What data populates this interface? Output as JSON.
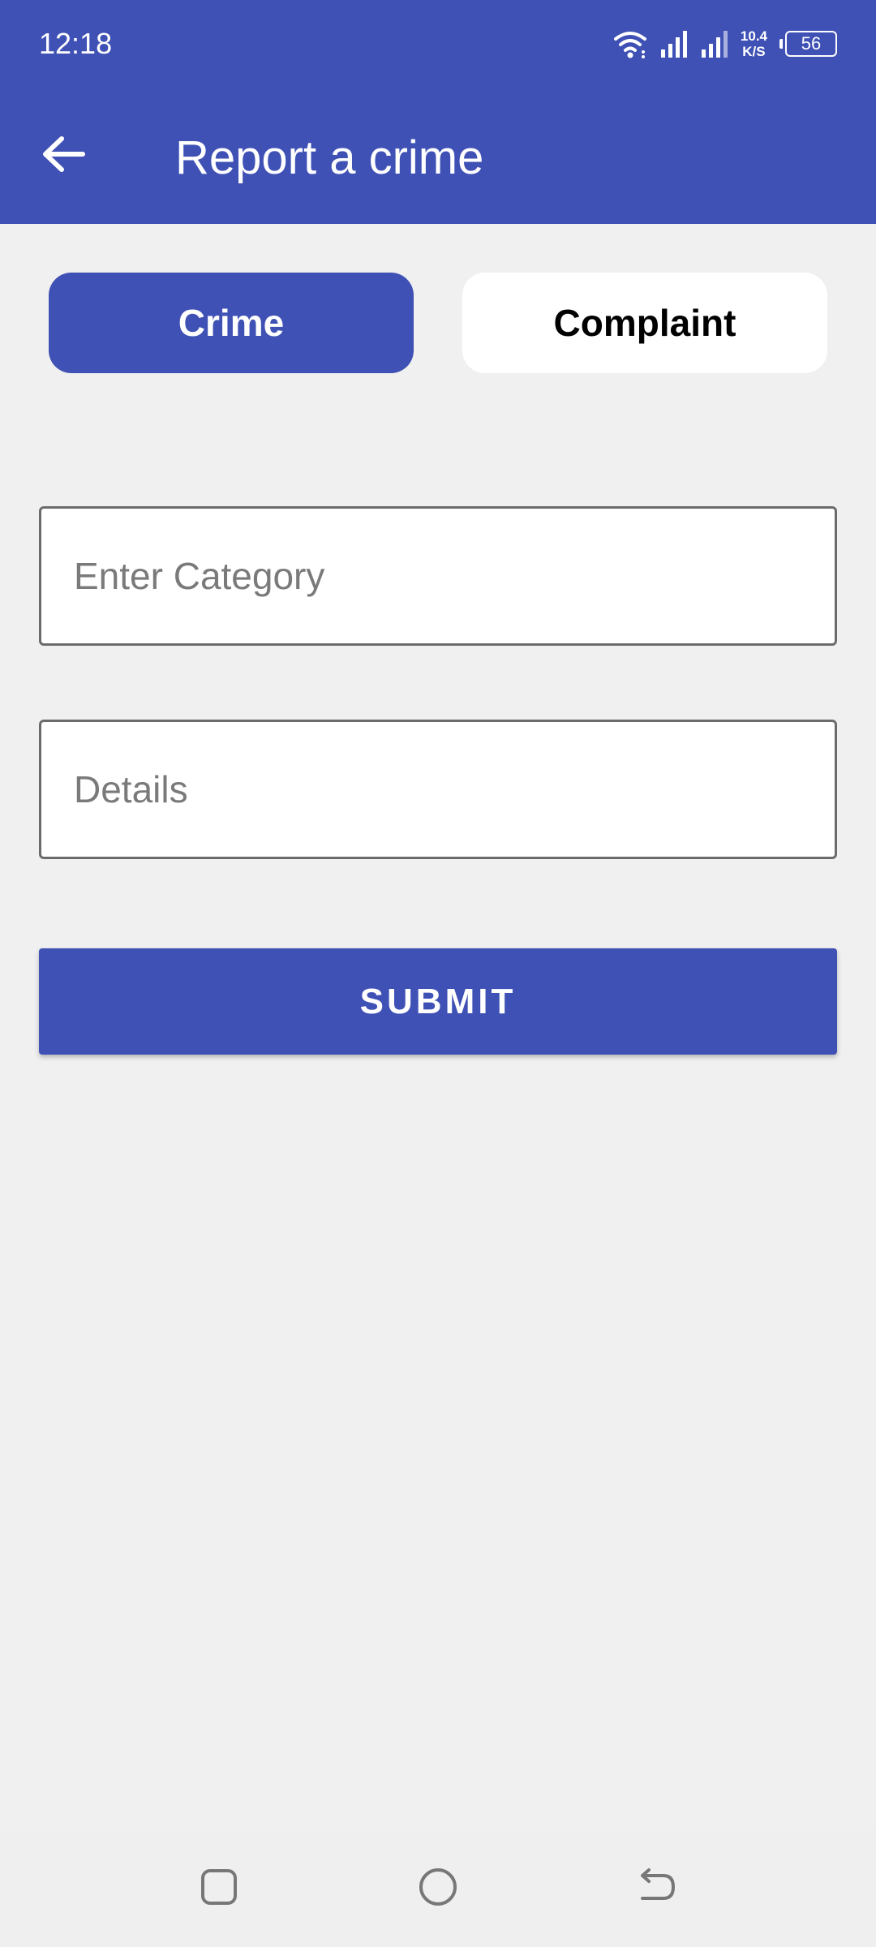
{
  "status_bar": {
    "time": "12:18",
    "net_speed_value": "10.4",
    "net_speed_unit": "K/S",
    "battery": "56",
    "icons": [
      "wifi-icon",
      "signal-icon",
      "signal-icon",
      "battery-icon"
    ]
  },
  "app_bar": {
    "back_icon": "arrow-back-icon",
    "title": "Report a crime"
  },
  "toggle": {
    "options": [
      {
        "label": "Crime",
        "selected": true
      },
      {
        "label": "Complaint",
        "selected": false
      }
    ]
  },
  "form": {
    "category_placeholder": "Enter Category",
    "category_value": "",
    "details_placeholder": "Details",
    "details_value": "",
    "submit_label": "SUBMIT"
  },
  "nav_bar": {
    "icons": [
      "recents-icon",
      "home-icon",
      "back-icon"
    ]
  },
  "colors": {
    "primary": "#3f51b5",
    "background": "#f0f0f0",
    "surface": "#ffffff",
    "field_border": "#6b6b6b",
    "placeholder": "#7a7a7a"
  }
}
